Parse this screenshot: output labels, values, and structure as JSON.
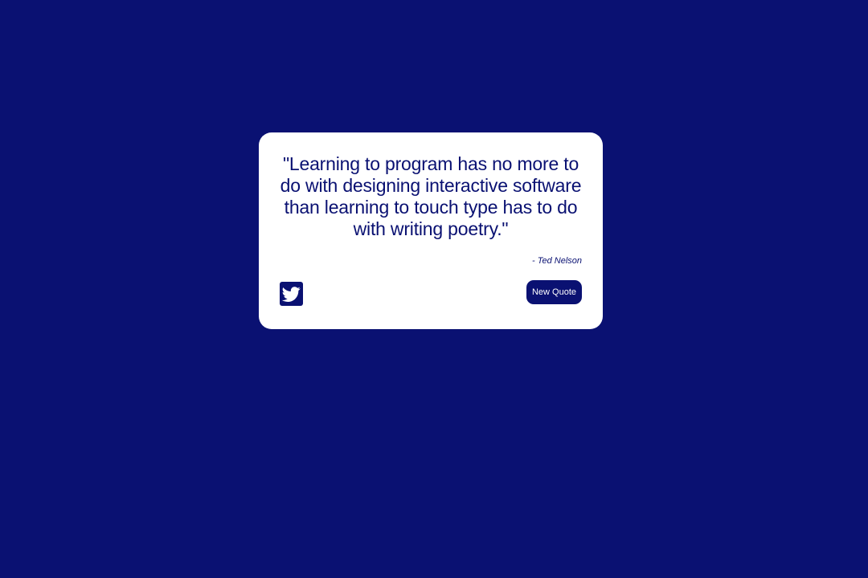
{
  "quote": {
    "text": "\"Learning to program has no more to do with designing interactive software than learning to touch type has to do with writing poetry.\"",
    "author": "- Ted Nelson"
  },
  "actions": {
    "tweet_icon": "twitter-bird-icon",
    "new_quote_label": "New Quote"
  },
  "colors": {
    "background": "#0a1172",
    "card": "#ffffff",
    "accent": "#0a1172"
  }
}
